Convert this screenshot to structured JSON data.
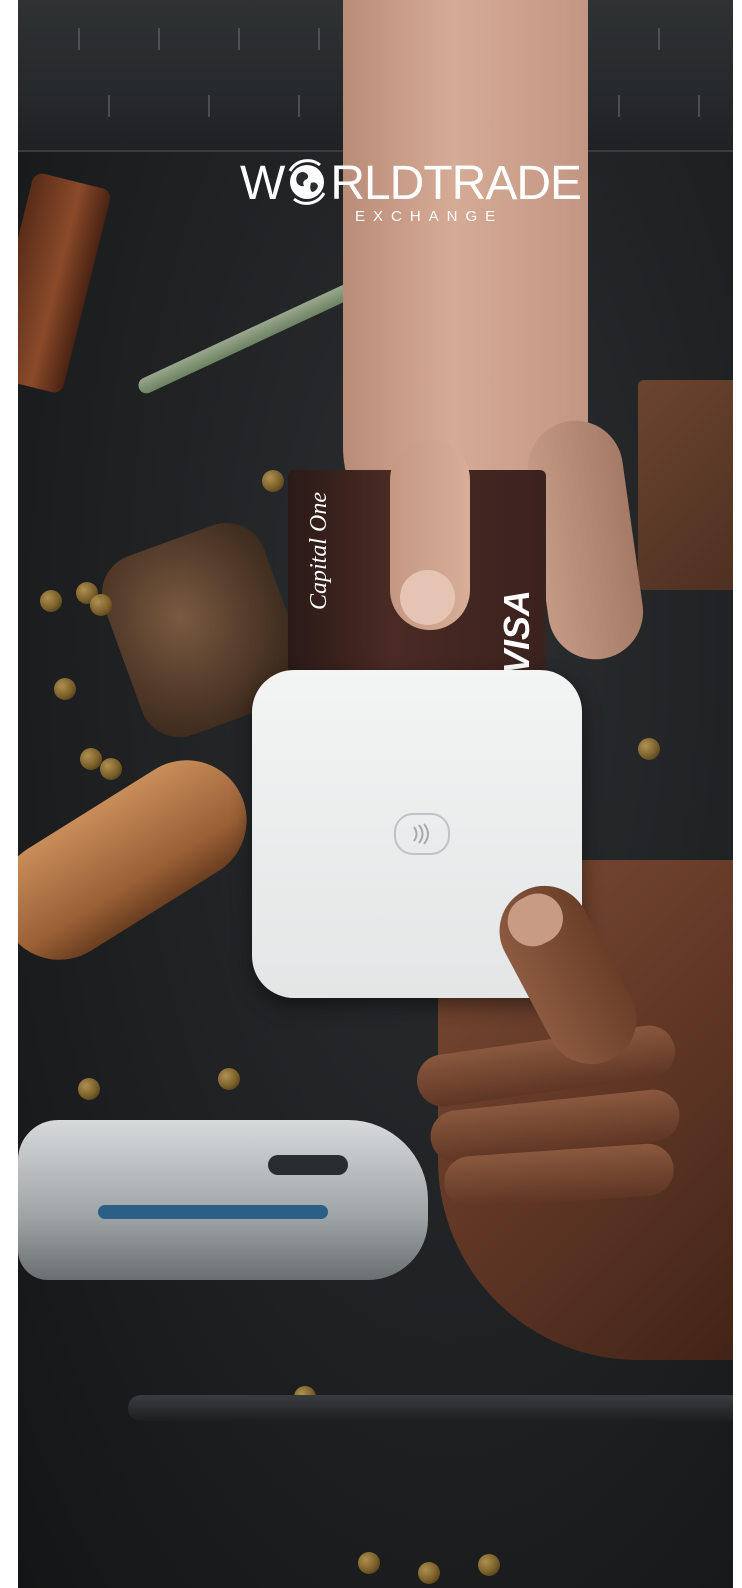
{
  "brand": {
    "name_part1": "W",
    "name_part2": "RLDTRADE",
    "tagline": "EXCHANGE"
  },
  "photo": {
    "card_issuer": "Capital One",
    "card_network": "VISA"
  },
  "icons": {
    "logo_globe": "globe-icon",
    "contactless": "contactless-icon"
  },
  "colors": {
    "background": "#1e2022",
    "logo_text": "#ffffff",
    "reader": "#eceeef"
  }
}
